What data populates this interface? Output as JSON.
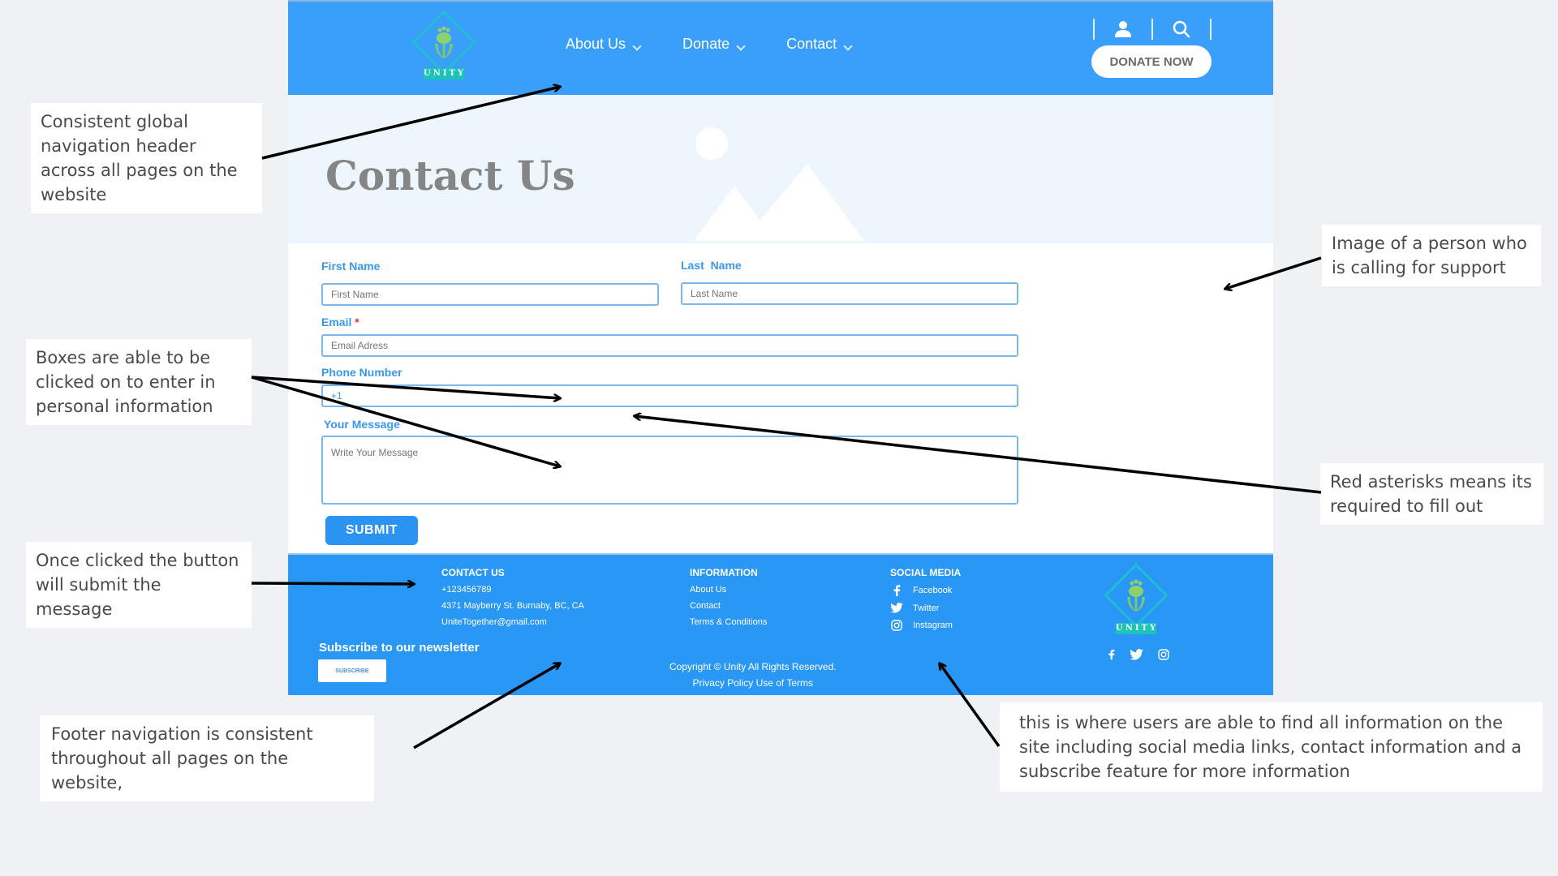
{
  "header": {
    "logo_text": "UNITY",
    "nav": [
      {
        "label": "About Us",
        "icon": "chevron-down-icon"
      },
      {
        "label": "Donate",
        "icon": "chevron-down-icon"
      },
      {
        "label": "Contact",
        "icon": "chevron-down-icon"
      }
    ],
    "utility_icons": [
      "user-icon",
      "search-icon"
    ],
    "donate_button": "DONATE NOW"
  },
  "hero": {
    "title": "Contact Us",
    "image": "image-placeholder-icon"
  },
  "form": {
    "first_name": {
      "label": "First Name",
      "placeholder": "First Name"
    },
    "last_name": {
      "label": "Last  Name",
      "placeholder": "Last Name"
    },
    "email": {
      "label": "Email",
      "required_mark": "*",
      "placeholder": "Email Adress"
    },
    "phone": {
      "label": "Phone Number",
      "value": "+1"
    },
    "message": {
      "label": "Your Message",
      "placeholder": "Write Your Message"
    },
    "submit": "SUBMIT"
  },
  "footer": {
    "contact": {
      "heading": "CONTACT US",
      "phone": "+123456789",
      "address": "4371 Mayberry St. Burnaby, BC, CA",
      "email": "UniteTogether@gmail.com"
    },
    "information": {
      "heading": "INFORMATION",
      "links": [
        "About Us",
        "Contact",
        "Terms & Conditions"
      ]
    },
    "social": {
      "heading": "SOCIAL MEDIA",
      "links": [
        {
          "label": "Facebook",
          "icon": "facebook-icon"
        },
        {
          "label": "Twitter",
          "icon": "twitter-icon"
        },
        {
          "label": "Instagram",
          "icon": "instagram-icon"
        }
      ]
    },
    "newsletter_title": "Subscribe to our newsletter",
    "subscribe_button": "SUBSCRIBE",
    "copyright": "Copyright © Unity All Rights Reserved.",
    "legal": "Privacy Policy Use of Terms",
    "logo_text": "UNITY"
  },
  "annotations": {
    "header_note": "Consistent global navigation header across all pages on the website",
    "image_note": "Image of a person who is calling for support",
    "boxes_note": "Boxes are able to be clicked on to enter in personal information",
    "asterisk_note": "Red asterisks means its required to fill out",
    "submit_note": "Once clicked the button will submit the message",
    "footer_nav_note": "Footer navigation is consistent throughout all pages on the website,",
    "footer_info_note": "this is where users are able to find all information on the site including social media links, contact information and a subscribe feature for more information"
  },
  "colors": {
    "brand_blue": "#3a9ffa",
    "footer_blue": "#2997f6",
    "field_text": "#3a98ec",
    "required": "#e53935",
    "logo_teal": "#1fc2c9",
    "logo_green": "#7cc576"
  }
}
